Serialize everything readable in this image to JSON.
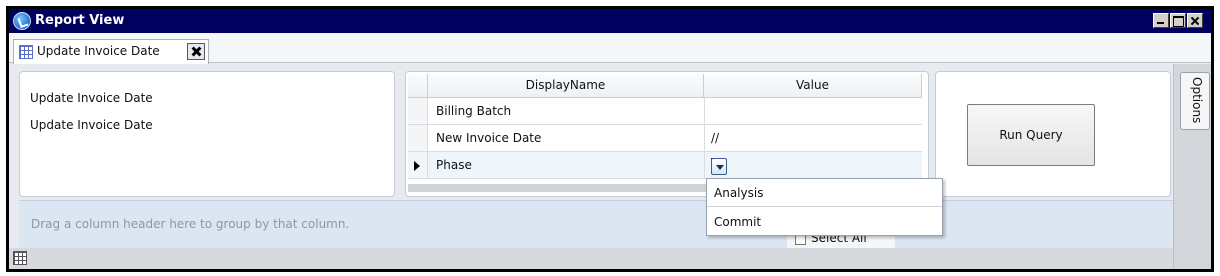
{
  "window": {
    "title": "Report View",
    "icon": "app-globe-icon"
  },
  "document_tab": {
    "label": "Update Invoice Date",
    "icon": "grid-icon",
    "close_icon": "close-icon"
  },
  "parameters_panel": {
    "lines": [
      "Update Invoice Date",
      "Update Invoice Date"
    ]
  },
  "param_grid": {
    "columns": [
      "DisplayName",
      "Value"
    ],
    "rows": [
      {
        "name": "Billing Batch",
        "value": ""
      },
      {
        "name": "New Invoice Date",
        "value": "//"
      },
      {
        "name": "Phase",
        "value": ""
      }
    ]
  },
  "phase_dropdown": {
    "options": [
      "Analysis",
      "Commit"
    ]
  },
  "run_button": {
    "label": "Run Query"
  },
  "group_bar": {
    "text": "Drag a column header here to group by that column."
  },
  "select_all": {
    "label": "Select All"
  },
  "options_tab": {
    "label": "Options"
  },
  "colors": {
    "title_bar": "#00005e",
    "group_bar": "#dbe6f2",
    "group_text": "#8a97a6"
  }
}
